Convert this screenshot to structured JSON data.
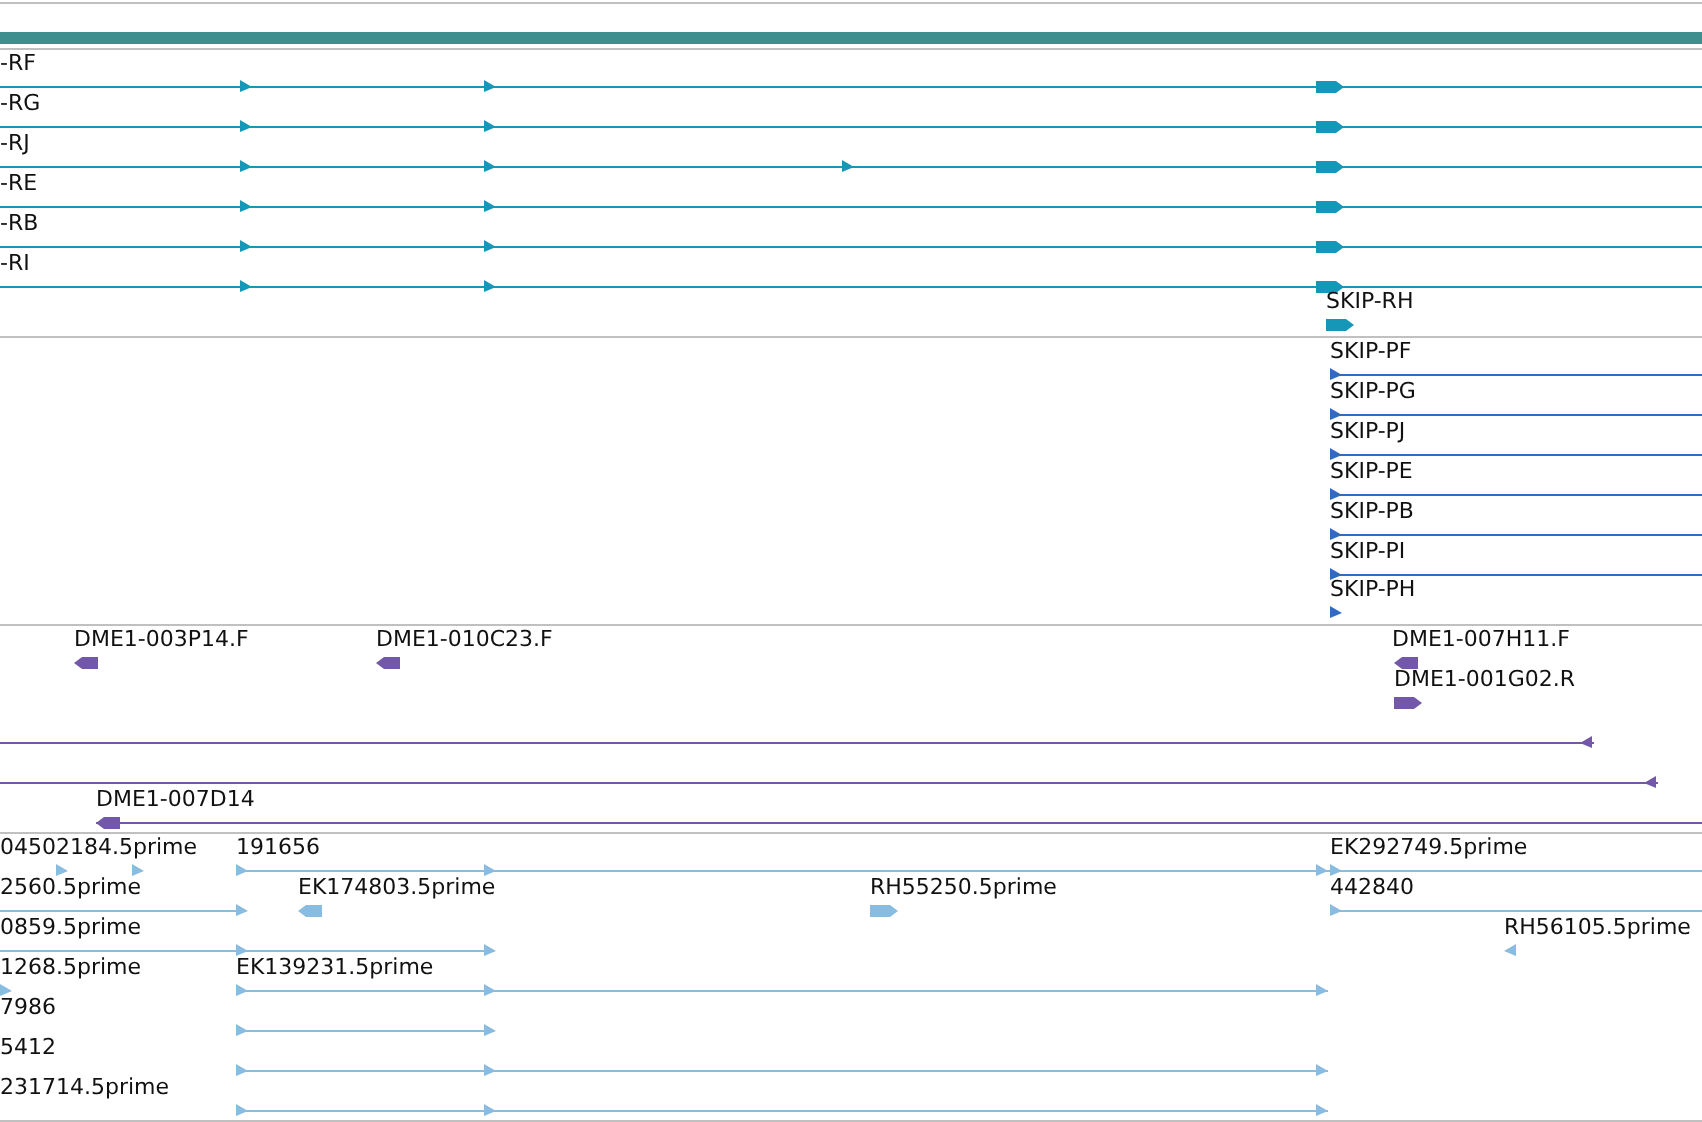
{
  "tracks": [
    {
      "color": "#1597b8",
      "features": [
        {
          "label": "-RF",
          "reverse": false
        },
        {
          "label": "-RG",
          "reverse": false
        },
        {
          "label": "-RJ",
          "reverse": false
        },
        {
          "label": "-RE",
          "reverse": false
        },
        {
          "label": "-RB",
          "reverse": false
        },
        {
          "label": "-RI",
          "reverse": false
        },
        {
          "label": "SKIP-RH",
          "reverse": false
        }
      ]
    },
    {
      "color": "#2f6bc0",
      "features": [
        {
          "label": "SKIP-PF",
          "reverse": false
        },
        {
          "label": "SKIP-PG",
          "reverse": false
        },
        {
          "label": "SKIP-PJ",
          "reverse": false
        },
        {
          "label": "SKIP-PE",
          "reverse": false
        },
        {
          "label": "SKIP-PB",
          "reverse": false
        },
        {
          "label": "SKIP-PI",
          "reverse": false
        },
        {
          "label": "SKIP-PH",
          "reverse": false
        }
      ]
    },
    {
      "color": "#7357a8",
      "features": [
        {
          "label": "DME1-003P14.F",
          "reverse": true
        },
        {
          "label": "DME1-010C23.F",
          "reverse": true
        },
        {
          "label": "DME1-007H11.F",
          "reverse": true
        },
        {
          "label": "DME1-001G02.R",
          "reverse": false
        },
        {
          "reverse": true
        },
        {
          "reverse": true
        },
        {
          "label": "DME1-007D14",
          "reverse": true
        }
      ]
    },
    {
      "color": "#88bce0",
      "features": [
        {
          "label": "04502184.5prime",
          "reverse": false
        },
        {
          "label": "191656",
          "reverse": false
        },
        {
          "label": "EK292749.5prime",
          "reverse": false
        },
        {
          "label": "2560.5prime",
          "reverse": false
        },
        {
          "label": "EK174803.5prime",
          "reverse": true
        },
        {
          "label": "RH55250.5prime",
          "reverse": false
        },
        {
          "label": "442840",
          "reverse": false
        },
        {
          "label": "0859.5prime",
          "reverse": false
        },
        {
          "label": "RH56105.5prime",
          "reverse": true
        },
        {
          "label": "1268.5prime",
          "reverse": false
        },
        {
          "label": "EK139231.5prime",
          "reverse": false
        },
        {
          "label": "7986",
          "reverse": false
        },
        {
          "label": "5412",
          "reverse": false
        },
        {
          "label": "231714.5prime",
          "reverse": false
        }
      ]
    }
  ]
}
